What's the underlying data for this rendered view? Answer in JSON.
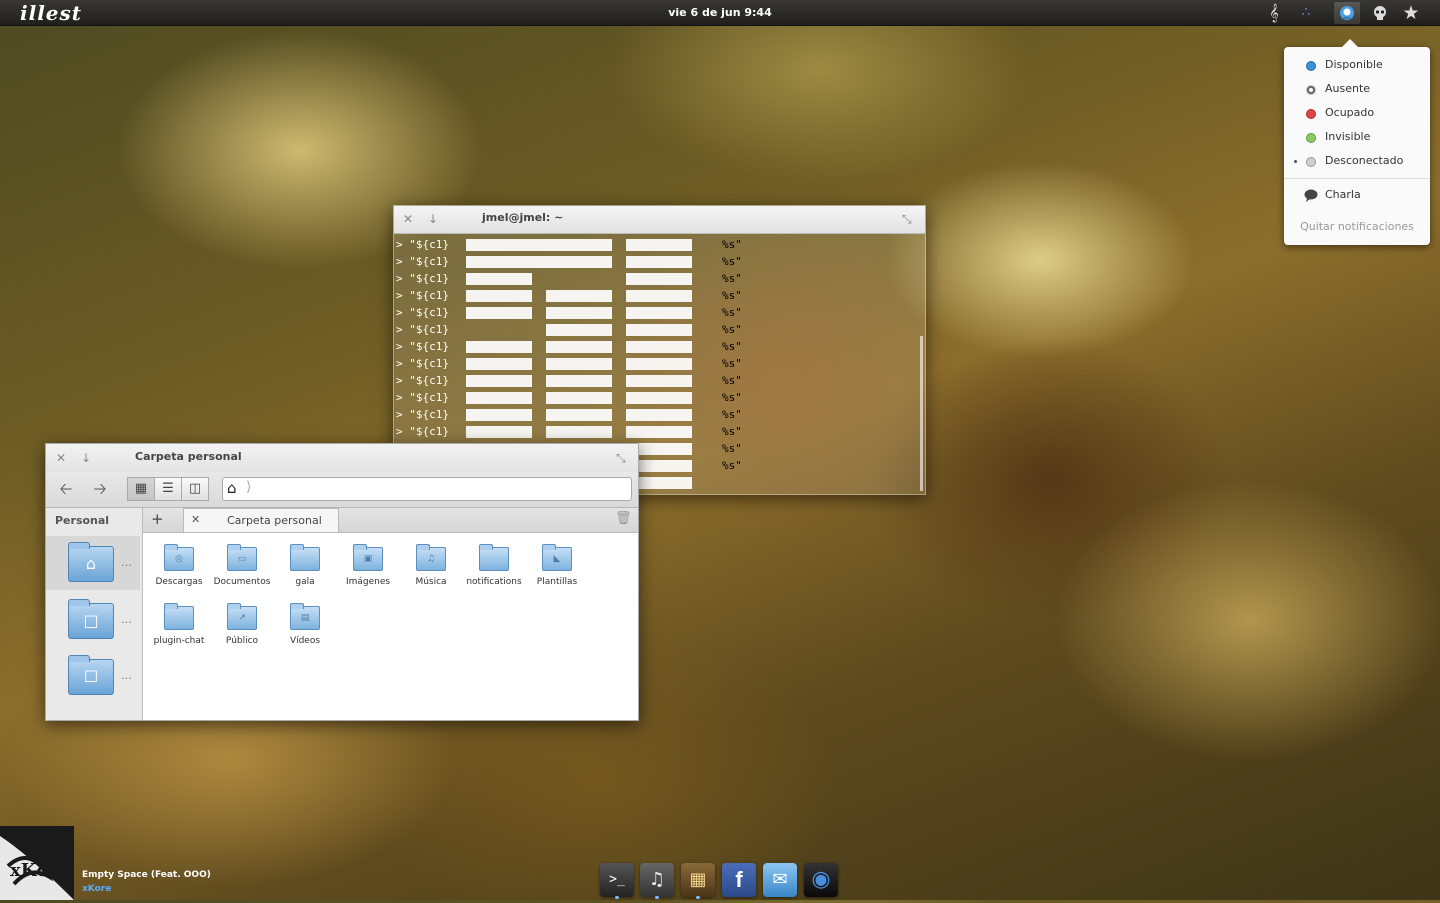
{
  "topbar": {
    "logo": "illest",
    "clock": "vie 6 de jun  9:44",
    "tray_icons": [
      "music-icon",
      "network-icon",
      "chat-status-icon",
      "skull-icon",
      "star-icon"
    ]
  },
  "status_menu": {
    "items": [
      {
        "label": "Disponible",
        "color": "#3b8fd8"
      },
      {
        "label": "Ausente",
        "color": "#666666"
      },
      {
        "label": "Ocupado",
        "color": "#e04444"
      },
      {
        "label": "Invisible",
        "color": "#88cc66"
      },
      {
        "label": "Desconectado",
        "color": "#cfcfcf",
        "current": true
      }
    ],
    "chat": "Charla",
    "clear": "Quitar notificaciones"
  },
  "terminal": {
    "title": "jmel@jmel: ~",
    "prompt": ">",
    "var": "\"${c1}",
    "fmt": "%s\"",
    "lines": 15
  },
  "file_manager": {
    "title": "Carpeta personal",
    "sidebar_header": "Personal",
    "tab_label": "Carpeta personal",
    "items": [
      {
        "label": "Descargas",
        "icon": "download-icon"
      },
      {
        "label": "Documentos",
        "icon": "document-icon"
      },
      {
        "label": "gala",
        "icon": "folder-icon"
      },
      {
        "label": "Imágenes",
        "icon": "image-icon"
      },
      {
        "label": "Música",
        "icon": "music-icon"
      },
      {
        "label": "notifications",
        "icon": "folder-icon"
      },
      {
        "label": "Plantillas",
        "icon": "template-icon"
      },
      {
        "label": "plugin-chat",
        "icon": "folder-icon"
      },
      {
        "label": "Público",
        "icon": "share-icon"
      },
      {
        "label": "Vídeos",
        "icon": "video-icon"
      }
    ]
  },
  "now_playing": {
    "title": "Empty Space (Feat. OOO)",
    "artist": "xKore"
  },
  "dock": {
    "items": [
      "terminal-icon",
      "music-player-icon",
      "calendar-icon",
      "facebook-icon",
      "mail-icon",
      "camera-icon"
    ]
  }
}
